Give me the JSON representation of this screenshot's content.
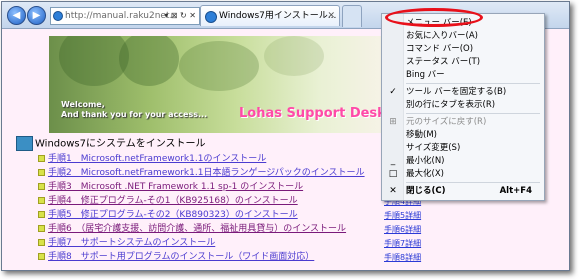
{
  "browser": {
    "address_url": "http://manual.raku2net.",
    "address_controls": "▾ ⊠ ↻ ✕",
    "tab_title": "Windows7用インストール..."
  },
  "page": {
    "banner_welcome_line1": "Welcome,",
    "banner_welcome_line2": "And thank you for your access...",
    "banner_logo": "Lohas Support Desk",
    "section_title": "Windows7にシステムをインストール",
    "steps": [
      {
        "text": "手順1　Microsoft.netFramework1.1のインストール",
        "color": "#3b34c8"
      },
      {
        "text": "手順2　Microsoft.netFramework1.1日本語ランゲージパックのインストール",
        "color": "#3b34c8"
      },
      {
        "text": "手順3　Microsoft .NET Framework 1.1 sp-1 のインストール",
        "color": "#7a1a7a"
      },
      {
        "text": "手順4　修正プログラム-その1（KB925168）のインストール",
        "color": "#7a1a7a"
      },
      {
        "text": "手順5　修正プログラム-その2（KB890323）のインストール",
        "color": "#3b34c8"
      },
      {
        "text": "手順6　（居宅介護支援、訪問介護、通所、福祉用具貸与）のインストール",
        "color": "#7a1a7a"
      },
      {
        "text": "手順7　サポートシステムのインストール",
        "color": "#3b34c8"
      },
      {
        "text": "手順8　サポート用プログラムのインストール（ワイド画面対応）",
        "color": "#3b34c8"
      }
    ],
    "step_detail_links": [
      "手順4詳細",
      "手順5詳細",
      "手順6詳細",
      "手順7詳細",
      "手順8詳細"
    ]
  },
  "context_menu": {
    "items": [
      {
        "label": "メニュー バー(E)",
        "mark": "",
        "shortcut": "",
        "disabled": false,
        "bold": false
      },
      {
        "label": "お気に入りバー(A)",
        "mark": "",
        "shortcut": "",
        "disabled": false,
        "bold": false
      },
      {
        "label": "コマンド バー(O)",
        "mark": "",
        "shortcut": "",
        "disabled": false,
        "bold": false
      },
      {
        "label": "ステータス バー(T)",
        "mark": "",
        "shortcut": "",
        "disabled": false,
        "bold": false
      },
      {
        "label": "Bing バー",
        "mark": "",
        "shortcut": "",
        "disabled": false,
        "bold": false
      },
      {
        "label": "ツール バーを固定する(B)",
        "mark": "✓",
        "shortcut": "",
        "disabled": false,
        "bold": false
      },
      {
        "label": "別の行にタブを表示(R)",
        "mark": "",
        "shortcut": "",
        "disabled": false,
        "bold": false
      },
      {
        "label": "元のサイズに戻す(R)",
        "mark": "⊞",
        "shortcut": "",
        "disabled": true,
        "bold": false
      },
      {
        "label": "移動(M)",
        "mark": "",
        "shortcut": "",
        "disabled": false,
        "bold": false
      },
      {
        "label": "サイズ変更(S)",
        "mark": "",
        "shortcut": "",
        "disabled": false,
        "bold": false
      },
      {
        "label": "最小化(N)",
        "mark": "_",
        "shortcut": "",
        "disabled": false,
        "bold": false
      },
      {
        "label": "最大化(X)",
        "mark": "□",
        "shortcut": "",
        "disabled": false,
        "bold": false
      },
      {
        "label": "閉じる(C)",
        "mark": "✕",
        "shortcut": "Alt+F4",
        "disabled": false,
        "bold": true
      }
    ]
  },
  "colors": {
    "page_background": "#fff0fa",
    "highlight_oval": "#e8101a",
    "link_blue": "#3b34c8",
    "link_visited": "#7a1a7a"
  }
}
